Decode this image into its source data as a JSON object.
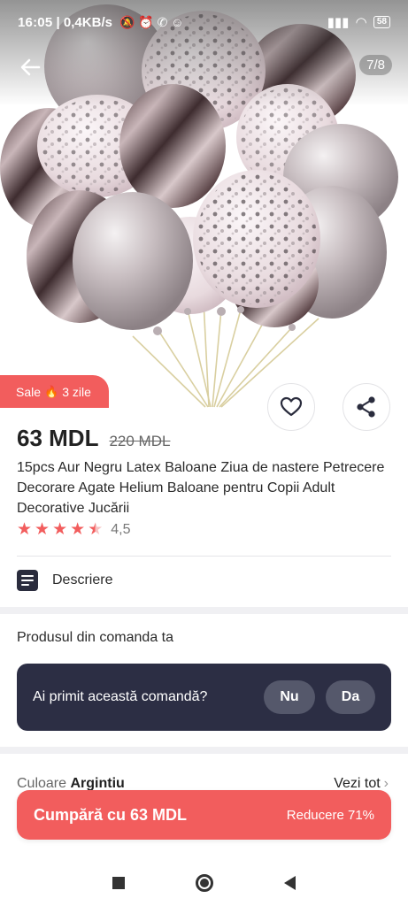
{
  "status_bar": {
    "time": "16:05",
    "net_speed": "0,4KB/s",
    "battery": "58"
  },
  "gallery": {
    "counter": "7/8",
    "image_icon": "balloon-bouquet-image"
  },
  "sale_badge": {
    "label": "Sale",
    "icon": "fire-icon",
    "days": "3 zile"
  },
  "product": {
    "price": "63 MDL",
    "old_price": "220 MDL",
    "title": "15pcs Aur Negru Latex Baloane Ziua de nastere Petrecere Decorare Agate Helium Baloane pentru Copii Adult Decorative Jucării",
    "rating": 4.5,
    "rating_text": "4,5"
  },
  "description": {
    "label": "Descriere"
  },
  "order": {
    "title": "Produsul din comanda ta",
    "question": "Ai primit această comandă?",
    "no_label": "Nu",
    "yes_label": "Da"
  },
  "color": {
    "label": "Culoare",
    "value": "Argintiu",
    "see_all": "Vezi tot"
  },
  "buy": {
    "label": "Cumpără cu 63 MDL",
    "discount": "Reducere 71%"
  },
  "colors": {
    "accent": "#f25d5d",
    "dark_panel": "#2c2e44"
  }
}
